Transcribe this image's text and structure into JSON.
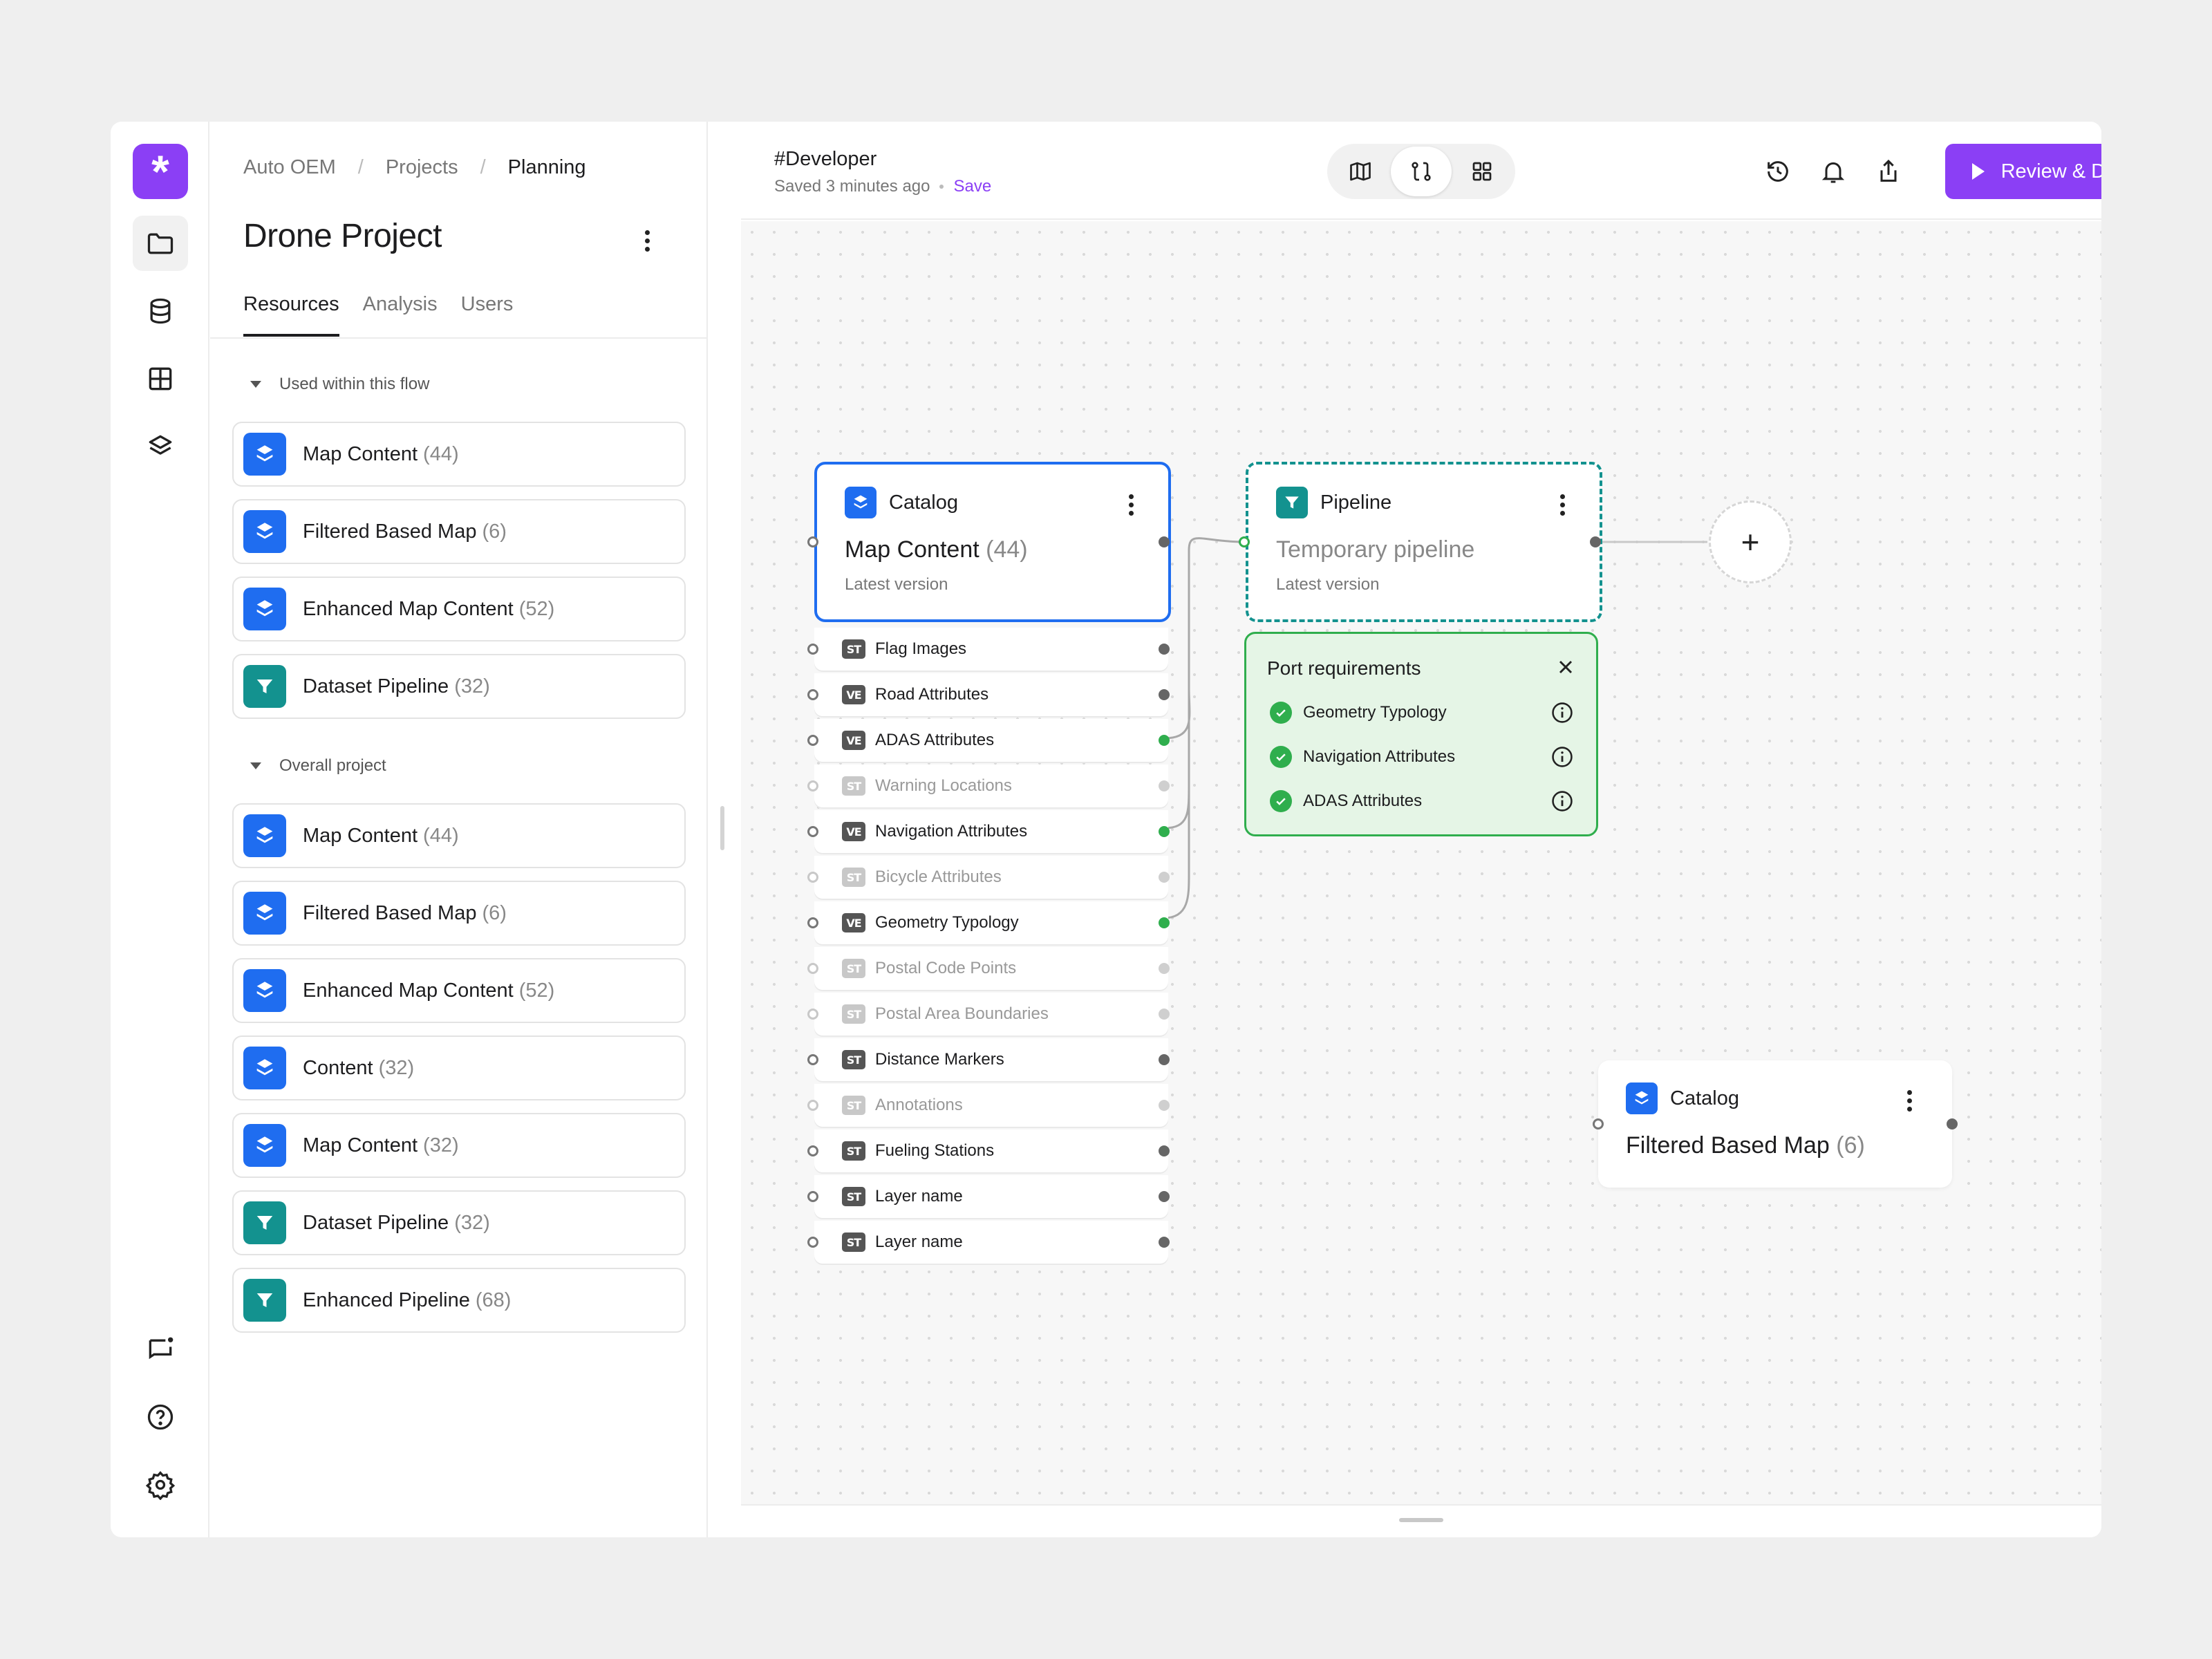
{
  "rail": {
    "logo": "*",
    "nav": [
      "folder-icon",
      "database-icon",
      "grid-icon",
      "layers-icon"
    ],
    "bottom": [
      "chat-icon",
      "help-icon",
      "settings-icon"
    ]
  },
  "panel": {
    "breadcrumb": [
      "Auto OEM",
      "Projects",
      "Planning"
    ],
    "title": "Drone Project",
    "tabs": [
      "Resources",
      "Analysis",
      "Users"
    ],
    "active_tab": "Resources",
    "groups": [
      {
        "label": "Used within this flow",
        "items": [
          {
            "name": "Map Content",
            "count": "(44)",
            "type": "catalog"
          },
          {
            "name": "Filtered Based Map",
            "count": "(6)",
            "type": "catalog"
          },
          {
            "name": "Enhanced Map Content",
            "count": "(52)",
            "type": "catalog"
          },
          {
            "name": "Dataset Pipeline",
            "count": "(32)",
            "type": "pipeline"
          }
        ]
      },
      {
        "label": "Overall project",
        "items": [
          {
            "name": "Map Content",
            "count": "(44)",
            "type": "catalog"
          },
          {
            "name": "Filtered Based Map",
            "count": "(6)",
            "type": "catalog"
          },
          {
            "name": "Enhanced Map Content",
            "count": "(52)",
            "type": "catalog"
          },
          {
            "name": "Content",
            "count": "(32)",
            "type": "catalog"
          },
          {
            "name": "Map Content",
            "count": "(32)",
            "type": "catalog"
          },
          {
            "name": "Dataset Pipeline",
            "count": "(32)",
            "type": "pipeline"
          },
          {
            "name": "Enhanced Pipeline",
            "count": "(68)",
            "type": "pipeline"
          }
        ]
      }
    ]
  },
  "topbar": {
    "title": "#Developer",
    "status": "Saved 3 minutes ago",
    "save_label": "Save",
    "view_modes": [
      "map-icon",
      "flow-icon",
      "grid-icon"
    ],
    "active_view": "flow-icon",
    "actions": [
      "history-icon",
      "bell-icon",
      "share-icon"
    ],
    "deploy_label": "Review & Deploy"
  },
  "canvas": {
    "catalog_node": {
      "kind": "Catalog",
      "name": "Map Content",
      "count": "(44)",
      "version": "Latest version"
    },
    "pipeline_node": {
      "kind": "Pipeline",
      "name": "Temporary pipeline",
      "version": "Latest version"
    },
    "layers": [
      {
        "tag": "ST",
        "name": "Flag Images",
        "state": "normal"
      },
      {
        "tag": "VE",
        "name": "Road Attributes",
        "state": "normal"
      },
      {
        "tag": "VE",
        "name": "ADAS Attributes",
        "state": "connected"
      },
      {
        "tag": "ST",
        "name": "Warning Locations",
        "state": "dim"
      },
      {
        "tag": "VE",
        "name": "Navigation Attributes",
        "state": "connected"
      },
      {
        "tag": "ST",
        "name": "Bicycle Attributes",
        "state": "dim"
      },
      {
        "tag": "VE",
        "name": "Geometry Typology",
        "state": "connected"
      },
      {
        "tag": "ST",
        "name": "Postal Code Points",
        "state": "dim"
      },
      {
        "tag": "ST",
        "name": "Postal Area Boundaries",
        "state": "dim"
      },
      {
        "tag": "ST",
        "name": "Distance Markers",
        "state": "normal"
      },
      {
        "tag": "ST",
        "name": "Annotations",
        "state": "dim"
      },
      {
        "tag": "ST",
        "name": "Fueling Stations",
        "state": "normal"
      },
      {
        "tag": "ST",
        "name": "Layer name",
        "state": "normal"
      },
      {
        "tag": "ST",
        "name": "Layer name",
        "state": "normal"
      }
    ],
    "port_requirements": {
      "title": "Port requirements",
      "items": [
        "Geometry Typology",
        "Navigation Attributes",
        "ADAS Attributes"
      ]
    },
    "add_label": "+",
    "catalog_node_2": {
      "kind": "Catalog",
      "name": "Filtered Based Map",
      "count": "(6)"
    }
  },
  "colors": {
    "accent": "#8b3ff5",
    "catalog": "#1f6df0",
    "pipeline": "#13928f",
    "success": "#2fae4d"
  }
}
